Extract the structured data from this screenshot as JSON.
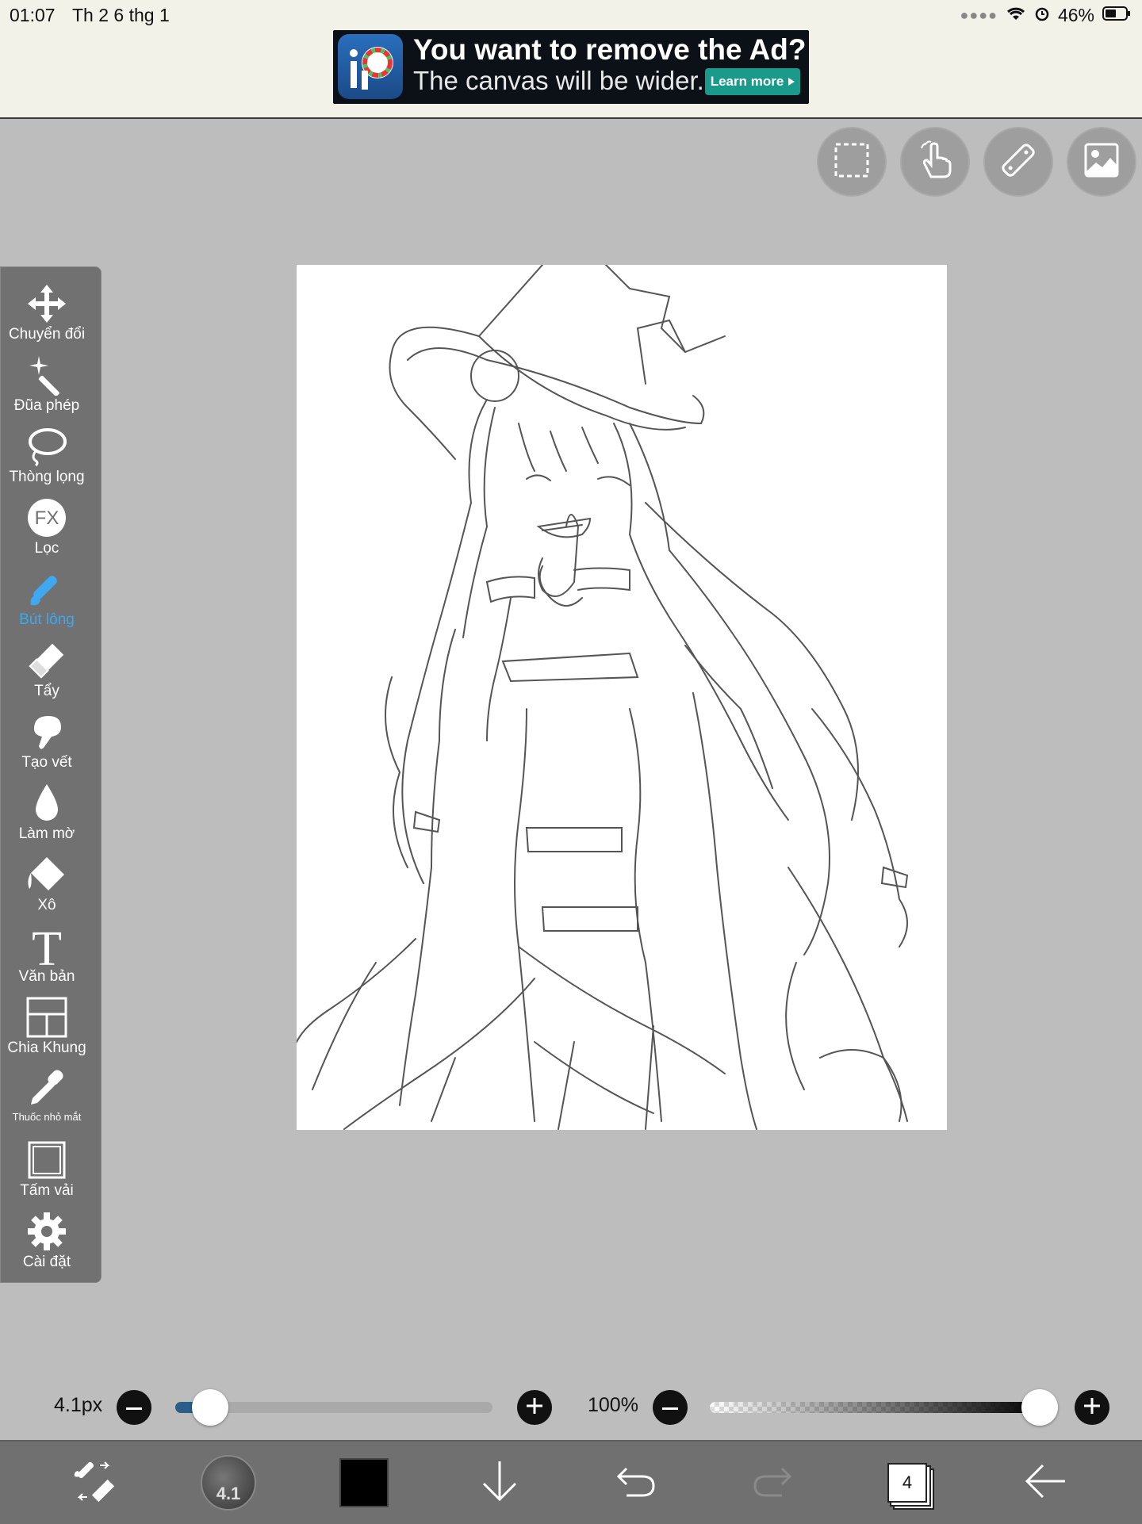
{
  "status_bar": {
    "time": "01:07",
    "date": "Th 2 6 thg 1",
    "battery": "46%"
  },
  "ad": {
    "title": "You want to remove the Ad?",
    "subtitle": "The canvas will be wider.",
    "button": "Learn more"
  },
  "top_tools": [
    {
      "name": "selection",
      "icon": "selection-icon"
    },
    {
      "name": "hand",
      "icon": "touch-hand-icon"
    },
    {
      "name": "ruler",
      "icon": "ruler-icon"
    },
    {
      "name": "material",
      "icon": "image-icon"
    }
  ],
  "toolbar": {
    "items": [
      {
        "label": "Chuyển đổi",
        "icon": "move-icon"
      },
      {
        "label": "Đũa phép",
        "icon": "magic-wand-icon"
      },
      {
        "label": "Thòng lọng",
        "icon": "lasso-icon"
      },
      {
        "label": "Lọc",
        "icon": "fx-filter-icon"
      },
      {
        "label": "Bút lông",
        "icon": "brush-icon",
        "active": true
      },
      {
        "label": "Tẩy",
        "icon": "eraser-icon"
      },
      {
        "label": "Tạo vết",
        "icon": "smudge-icon"
      },
      {
        "label": "Làm mờ",
        "icon": "blur-drop-icon"
      },
      {
        "label": "Xô",
        "icon": "bucket-icon"
      },
      {
        "label": "Văn bản",
        "icon": "text-icon"
      },
      {
        "label": "Chia Khung",
        "icon": "frame-divider-icon"
      },
      {
        "label": "Thuốc nhỏ mắt",
        "icon": "eyedropper-icon"
      },
      {
        "label": "Tấm vải",
        "icon": "canvas-icon"
      },
      {
        "label": "Cài đặt",
        "icon": "gear-icon"
      }
    ]
  },
  "sliders": {
    "brush_size_label": "4.1px",
    "brush_size_fraction": 0.11,
    "opacity_label": "100%",
    "opacity_fraction": 1.0
  },
  "bottom_bar": {
    "brush_size_badge": "4.1",
    "color": "#000000",
    "layers_count": "4"
  },
  "colors": {
    "accent": "#3ea8f0",
    "toolbar": "#717171",
    "workspace": "#bdbdbd"
  }
}
